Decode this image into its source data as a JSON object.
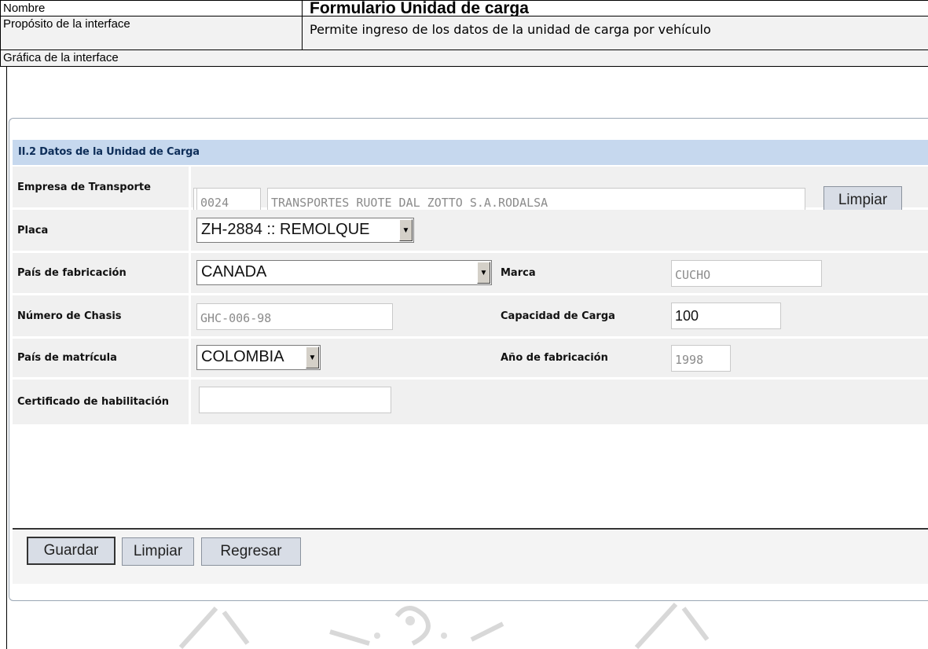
{
  "doc": {
    "name_label": "Nombre",
    "form_title": "Formulario Unidad de carga",
    "purpose_label": "Propósito de la interface",
    "purpose_text": "Permite ingreso de los datos de la unidad de carga por vehículo",
    "graphic_label": "Gráfica de la interface"
  },
  "form": {
    "section_title": "II.2 Datos de la Unidad de Carga",
    "empresa": {
      "label": "Empresa de Transporte",
      "code": "0024",
      "name": "TRANSPORTES RUOTE DAL ZOTTO S.A.RODALSA",
      "clear_button": "Limpiar"
    },
    "placa": {
      "label": "Placa",
      "value": "ZH-2884 :: REMOLQUE"
    },
    "pais_fabricacion": {
      "label": "País de fabricación",
      "value": "CANADA"
    },
    "marca": {
      "label": "Marca",
      "value": "CUCHO"
    },
    "chasis": {
      "label": "Número de Chasis",
      "value": "GHC-006-98"
    },
    "capacidad": {
      "label": "Capacidad de Carga",
      "value": "100"
    },
    "pais_matricula": {
      "label": "País de matrícula",
      "value": "COLOMBIA"
    },
    "anio": {
      "label": "Año de fabricación",
      "value": "1998"
    },
    "certificado": {
      "label": "Certificado de habilitación",
      "value": ""
    }
  },
  "buttons": {
    "save": "Guardar",
    "clear": "Limpiar",
    "back": "Regresar"
  },
  "icons": {
    "dropdown": "dropdown-arrow-icon",
    "watermark": "university-seal-watermark"
  },
  "colors": {
    "section_header": "#c6d8ee",
    "section_title": "#0e2e59",
    "row_bg": "#f0f0f0",
    "button_bg": "#d8dde6"
  }
}
